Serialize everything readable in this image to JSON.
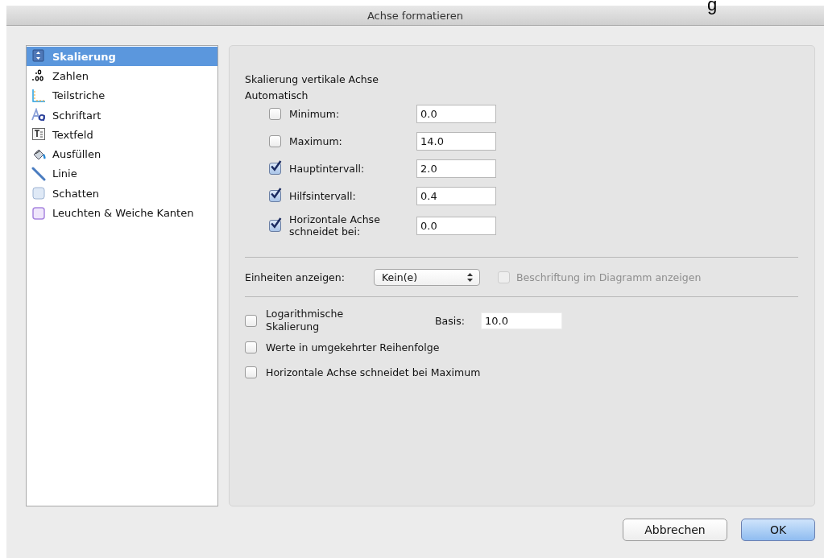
{
  "background_text": "g",
  "window": {
    "title": "Achse formatieren"
  },
  "sidebar": {
    "items": [
      {
        "label": "Skalierung",
        "kind": "scaling",
        "selected": true
      },
      {
        "label": "Zahlen",
        "kind": "numbers",
        "selected": false
      },
      {
        "label": "Teilstriche",
        "kind": "ticks",
        "selected": false
      },
      {
        "label": "Schriftart",
        "kind": "font",
        "selected": false
      },
      {
        "label": "Textfeld",
        "kind": "textbox",
        "selected": false
      },
      {
        "label": "Ausfüllen",
        "kind": "fill",
        "selected": false
      },
      {
        "label": "Linie",
        "kind": "line",
        "selected": false
      },
      {
        "label": "Schatten",
        "kind": "shadow",
        "selected": false
      },
      {
        "label": "Leuchten & Weiche Kanten",
        "kind": "glow",
        "selected": false
      }
    ]
  },
  "panel": {
    "heading": "Skalierung vertikale Achse",
    "auto_label": "Automatisch",
    "auto_rows": [
      {
        "label": "Minimum:",
        "checked": false,
        "value": "0.0"
      },
      {
        "label": "Maximum:",
        "checked": false,
        "value": "14.0"
      },
      {
        "label": "Hauptintervall:",
        "checked": true,
        "value": "2.0"
      },
      {
        "label": "Hilfsintervall:",
        "checked": true,
        "value": "0.4"
      },
      {
        "label": "Horizontale Achse schneidet bei:",
        "checked": true,
        "value": "0.0"
      }
    ],
    "units": {
      "label": "Einheiten anzeigen:",
      "value": "Kein(e)",
      "chart_label": {
        "label": "Beschriftung im Diagramm anzeigen",
        "checked": false,
        "disabled": true
      }
    },
    "log": {
      "label": "Logarithmische Skalierung",
      "checked": false,
      "base_label": "Basis:",
      "base_value": "10.0"
    },
    "options": [
      {
        "label": "Werte in umgekehrter Reihenfolge",
        "checked": false
      },
      {
        "label": "Horizontale Achse schneidet bei Maximum",
        "checked": false
      }
    ]
  },
  "buttons": [
    {
      "label": "Abbrechen",
      "kind": "normal"
    },
    {
      "label": "OK",
      "kind": "default"
    }
  ]
}
